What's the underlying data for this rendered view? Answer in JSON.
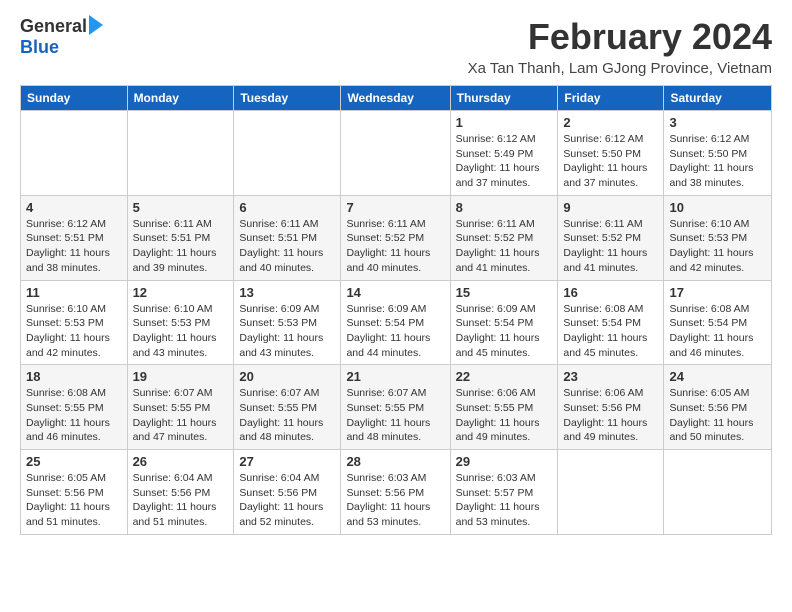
{
  "logo": {
    "general": "General",
    "blue": "Blue"
  },
  "title": {
    "month": "February 2024",
    "location": "Xa Tan Thanh, Lam GJong Province, Vietnam"
  },
  "headers": [
    "Sunday",
    "Monday",
    "Tuesday",
    "Wednesday",
    "Thursday",
    "Friday",
    "Saturday"
  ],
  "weeks": [
    [
      {
        "day": "",
        "info": ""
      },
      {
        "day": "",
        "info": ""
      },
      {
        "day": "",
        "info": ""
      },
      {
        "day": "",
        "info": ""
      },
      {
        "day": "1",
        "info": "Sunrise: 6:12 AM\nSunset: 5:49 PM\nDaylight: 11 hours and 37 minutes."
      },
      {
        "day": "2",
        "info": "Sunrise: 6:12 AM\nSunset: 5:50 PM\nDaylight: 11 hours and 37 minutes."
      },
      {
        "day": "3",
        "info": "Sunrise: 6:12 AM\nSunset: 5:50 PM\nDaylight: 11 hours and 38 minutes."
      }
    ],
    [
      {
        "day": "4",
        "info": "Sunrise: 6:12 AM\nSunset: 5:51 PM\nDaylight: 11 hours and 38 minutes."
      },
      {
        "day": "5",
        "info": "Sunrise: 6:11 AM\nSunset: 5:51 PM\nDaylight: 11 hours and 39 minutes."
      },
      {
        "day": "6",
        "info": "Sunrise: 6:11 AM\nSunset: 5:51 PM\nDaylight: 11 hours and 40 minutes."
      },
      {
        "day": "7",
        "info": "Sunrise: 6:11 AM\nSunset: 5:52 PM\nDaylight: 11 hours and 40 minutes."
      },
      {
        "day": "8",
        "info": "Sunrise: 6:11 AM\nSunset: 5:52 PM\nDaylight: 11 hours and 41 minutes."
      },
      {
        "day": "9",
        "info": "Sunrise: 6:11 AM\nSunset: 5:52 PM\nDaylight: 11 hours and 41 minutes."
      },
      {
        "day": "10",
        "info": "Sunrise: 6:10 AM\nSunset: 5:53 PM\nDaylight: 11 hours and 42 minutes."
      }
    ],
    [
      {
        "day": "11",
        "info": "Sunrise: 6:10 AM\nSunset: 5:53 PM\nDaylight: 11 hours and 42 minutes."
      },
      {
        "day": "12",
        "info": "Sunrise: 6:10 AM\nSunset: 5:53 PM\nDaylight: 11 hours and 43 minutes."
      },
      {
        "day": "13",
        "info": "Sunrise: 6:09 AM\nSunset: 5:53 PM\nDaylight: 11 hours and 43 minutes."
      },
      {
        "day": "14",
        "info": "Sunrise: 6:09 AM\nSunset: 5:54 PM\nDaylight: 11 hours and 44 minutes."
      },
      {
        "day": "15",
        "info": "Sunrise: 6:09 AM\nSunset: 5:54 PM\nDaylight: 11 hours and 45 minutes."
      },
      {
        "day": "16",
        "info": "Sunrise: 6:08 AM\nSunset: 5:54 PM\nDaylight: 11 hours and 45 minutes."
      },
      {
        "day": "17",
        "info": "Sunrise: 6:08 AM\nSunset: 5:54 PM\nDaylight: 11 hours and 46 minutes."
      }
    ],
    [
      {
        "day": "18",
        "info": "Sunrise: 6:08 AM\nSunset: 5:55 PM\nDaylight: 11 hours and 46 minutes."
      },
      {
        "day": "19",
        "info": "Sunrise: 6:07 AM\nSunset: 5:55 PM\nDaylight: 11 hours and 47 minutes."
      },
      {
        "day": "20",
        "info": "Sunrise: 6:07 AM\nSunset: 5:55 PM\nDaylight: 11 hours and 48 minutes."
      },
      {
        "day": "21",
        "info": "Sunrise: 6:07 AM\nSunset: 5:55 PM\nDaylight: 11 hours and 48 minutes."
      },
      {
        "day": "22",
        "info": "Sunrise: 6:06 AM\nSunset: 5:55 PM\nDaylight: 11 hours and 49 minutes."
      },
      {
        "day": "23",
        "info": "Sunrise: 6:06 AM\nSunset: 5:56 PM\nDaylight: 11 hours and 49 minutes."
      },
      {
        "day": "24",
        "info": "Sunrise: 6:05 AM\nSunset: 5:56 PM\nDaylight: 11 hours and 50 minutes."
      }
    ],
    [
      {
        "day": "25",
        "info": "Sunrise: 6:05 AM\nSunset: 5:56 PM\nDaylight: 11 hours and 51 minutes."
      },
      {
        "day": "26",
        "info": "Sunrise: 6:04 AM\nSunset: 5:56 PM\nDaylight: 11 hours and 51 minutes."
      },
      {
        "day": "27",
        "info": "Sunrise: 6:04 AM\nSunset: 5:56 PM\nDaylight: 11 hours and 52 minutes."
      },
      {
        "day": "28",
        "info": "Sunrise: 6:03 AM\nSunset: 5:56 PM\nDaylight: 11 hours and 53 minutes."
      },
      {
        "day": "29",
        "info": "Sunrise: 6:03 AM\nSunset: 5:57 PM\nDaylight: 11 hours and 53 minutes."
      },
      {
        "day": "",
        "info": ""
      },
      {
        "day": "",
        "info": ""
      }
    ]
  ]
}
